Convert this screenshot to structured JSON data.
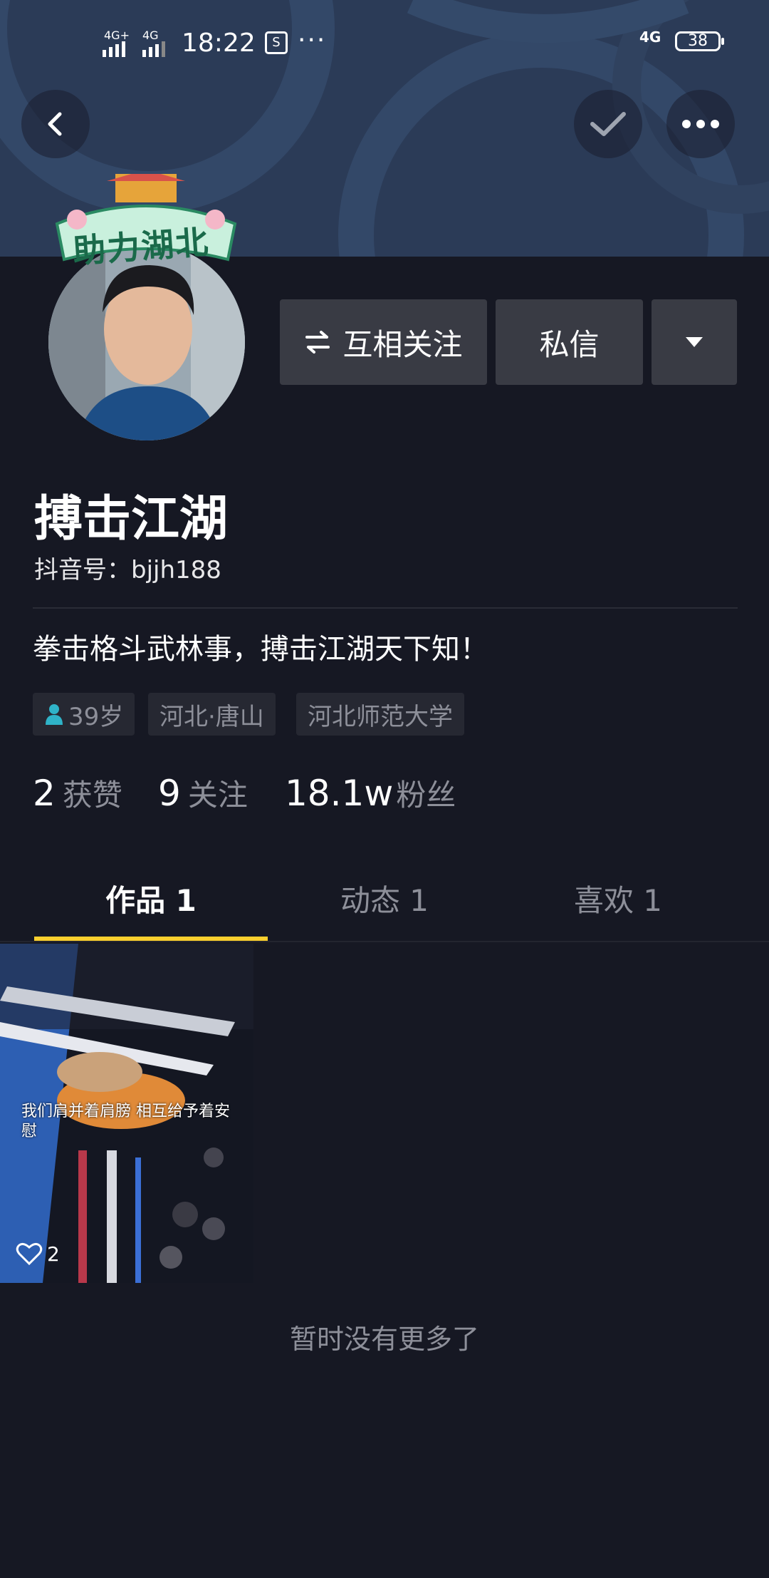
{
  "status_bar": {
    "signal1": "4G+",
    "signal2": "4G",
    "time": "18:22",
    "more": "···",
    "network": "4G",
    "battery": "38"
  },
  "header": {
    "back_icon": "chevron-left-icon",
    "check_icon": "check-icon",
    "more_icon": "ellipsis-icon"
  },
  "profile": {
    "avatar_badge": "助力湖北",
    "nickname": "搏击江湖",
    "douyin_id": "抖音号：bjjh188",
    "bio": "拳击格斗武林事，搏击江湖天下知！",
    "tags": [
      "39岁",
      "河北·唐山",
      "河北师范大学"
    ]
  },
  "actions": {
    "mutual_follow": "互相关注",
    "message": "私信"
  },
  "stats": {
    "likes_value": "2",
    "likes_label": "获赞",
    "following_value": "9",
    "following_label": "关注",
    "followers_value": "18.1w",
    "followers_label": "粉丝"
  },
  "tabs": [
    {
      "label": "作品 1"
    },
    {
      "label": "动态 1"
    },
    {
      "label": "喜欢 1"
    }
  ],
  "videos": [
    {
      "caption": "我们肩并着肩膀 相互给予着安慰",
      "likes": "2"
    }
  ],
  "footer": {
    "no_more": "暂时没有更多了"
  },
  "colors": {
    "background": "#161823",
    "accent": "#facf2e",
    "button": "#393b44"
  }
}
